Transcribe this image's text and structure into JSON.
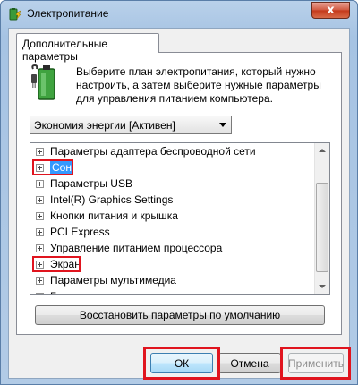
{
  "window": {
    "title": "Электропитание",
    "close_glyph": "x",
    "icon": "power-options-icon"
  },
  "tab": {
    "label": "Дополнительные параметры"
  },
  "description": "Выберите план электропитания, который нужно настроить, а затем выберите нужные параметры для управления питанием компьютера.",
  "plan_select": {
    "selected": "Экономия энергии [Активен]"
  },
  "tree": {
    "items": [
      {
        "label": "Параметры адаптера беспроводной сети",
        "selected": false,
        "highlighted": false
      },
      {
        "label": "Сон",
        "selected": true,
        "highlighted": true
      },
      {
        "label": "Параметры USB",
        "selected": false,
        "highlighted": false
      },
      {
        "label": "Intel(R) Graphics Settings",
        "selected": false,
        "highlighted": false
      },
      {
        "label": "Кнопки питания и крышка",
        "selected": false,
        "highlighted": false
      },
      {
        "label": "PCI Express",
        "selected": false,
        "highlighted": false
      },
      {
        "label": "Управление питанием процессора",
        "selected": false,
        "highlighted": false
      },
      {
        "label": "Экран",
        "selected": false,
        "highlighted": true
      },
      {
        "label": "Параметры мультимедиа",
        "selected": false,
        "highlighted": false
      },
      {
        "label": "Батарея",
        "selected": false,
        "highlighted": false
      }
    ]
  },
  "buttons": {
    "restore": "Восстановить параметры по умолчанию",
    "ok": "ОК",
    "cancel": "Отмена",
    "apply": "Применить"
  },
  "colors": {
    "highlight": "#e0141e",
    "selection": "#3399ff"
  }
}
